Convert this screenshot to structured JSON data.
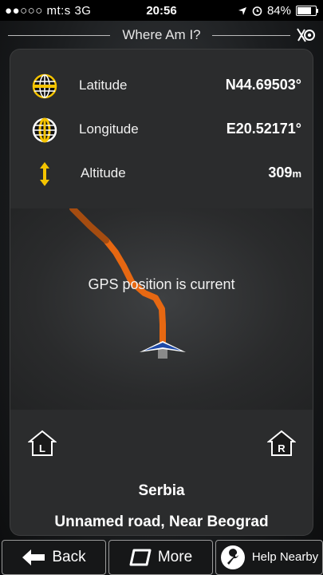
{
  "status_bar": {
    "carrier": "●●○○○ mt:s  3G",
    "time": "20:56",
    "battery": "84%",
    "battery_level": 0.84
  },
  "header": {
    "title": "Where Am I?",
    "gps_icon": "gps-off-icon"
  },
  "coordinates": {
    "latitude": {
      "label": "Latitude",
      "value": "N44.69503°",
      "icon": "globe-latitude-icon"
    },
    "longitude": {
      "label": "Longitude",
      "value": "E20.52171°",
      "icon": "globe-longitude-icon"
    },
    "altitude": {
      "label": "Altitude",
      "value": "309",
      "unit": "m",
      "icon": "altitude-arrow-icon"
    }
  },
  "map": {
    "gps_status": "GPS position is current",
    "route_color": "#f06a10"
  },
  "lanes": {
    "left": "L",
    "right": "R"
  },
  "location": {
    "country": "Serbia",
    "street": "Unnamed road, Near Beograd"
  },
  "toolbar": {
    "back": "Back",
    "more": "More",
    "help": "Help Nearby"
  },
  "colors": {
    "accent": "#f5c400",
    "panel": "#2b2c2d",
    "route": "#f06a10"
  }
}
